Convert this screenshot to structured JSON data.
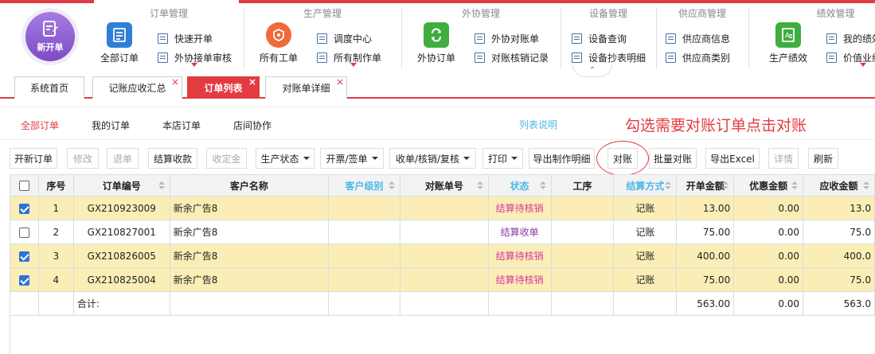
{
  "ribbon": {
    "new_order_label": "新开单",
    "collapse_icon": "chevron-up-icon",
    "groups": [
      {
        "title": "订单管理",
        "big_label": "全部订单",
        "small": [
          "快速开单",
          "外协接单审核"
        ]
      },
      {
        "title": "生产管理",
        "big_label": "所有工单",
        "small": [
          "调度中心",
          "所有制作单"
        ]
      },
      {
        "title": "外协管理",
        "big_label": "外协订单",
        "small": [
          "外协对账单",
          "对账核销记录"
        ]
      },
      {
        "title": "设备管理",
        "small": [
          "设备查询",
          "设备抄表明细"
        ]
      },
      {
        "title": "供应商管理",
        "small": [
          "供应商信息",
          "供应商类别"
        ]
      },
      {
        "title": "绩效管理",
        "big_label": "生产绩效",
        "small": [
          "我的绩效",
          "价值业绩"
        ]
      }
    ]
  },
  "tabs": [
    {
      "label": "系统首页",
      "closable": false
    },
    {
      "label": "记账应收汇总",
      "closable": true
    },
    {
      "label": "订单列表",
      "closable": true,
      "active": true
    },
    {
      "label": "对账单详细",
      "closable": true
    }
  ],
  "subnav": {
    "items": [
      "全部订单",
      "我的订单",
      "本店订单",
      "店间协作"
    ],
    "active_index": 0,
    "help_link": "列表说明",
    "hint": "勾选需要对账订单点击对账"
  },
  "toolbar": {
    "buttons": [
      "开新订单",
      "修改",
      "退单",
      "结算收款",
      "收定金",
      "生产状态",
      "开票/签单",
      "收单/核销/复核",
      "打印",
      "导出制作明细",
      "对账",
      "批量对账",
      "导出Excel",
      "详情",
      "刷新"
    ]
  },
  "table": {
    "headers": [
      "序号",
      "订单编号",
      "客户名称",
      "客户级别",
      "对账单号",
      "状态",
      "工序",
      "结算方式",
      "开单金额",
      "优惠金额",
      "应收金额"
    ],
    "rows": [
      {
        "checked": true,
        "no": "1",
        "order_no": "GX210923009",
        "customer": "新余广告8",
        "level": "",
        "statement": "",
        "status": "结算待核销",
        "process": "",
        "settle": "记账",
        "amount": "13.00",
        "discount": "0.00",
        "receivable": "13.0"
      },
      {
        "checked": false,
        "no": "2",
        "order_no": "GX210827001",
        "customer": "新余广告8",
        "level": "",
        "statement": "",
        "status": "结算收单",
        "process": "",
        "settle": "记账",
        "amount": "75.00",
        "discount": "0.00",
        "receivable": "75.0"
      },
      {
        "checked": true,
        "no": "3",
        "order_no": "GX210826005",
        "customer": "新余广告8",
        "level": "",
        "statement": "",
        "status": "结算待核销",
        "process": "",
        "settle": "记账",
        "amount": "400.00",
        "discount": "0.00",
        "receivable": "400.0"
      },
      {
        "checked": true,
        "no": "4",
        "order_no": "GX210825004",
        "customer": "新余广告8",
        "level": "",
        "statement": "",
        "status": "结算待核销",
        "process": "",
        "settle": "记账",
        "amount": "75.00",
        "discount": "0.00",
        "receivable": "75.0"
      }
    ],
    "total": {
      "label": "合计:",
      "amount": "563.00",
      "discount": "0.00",
      "receivable": "563.0"
    }
  }
}
